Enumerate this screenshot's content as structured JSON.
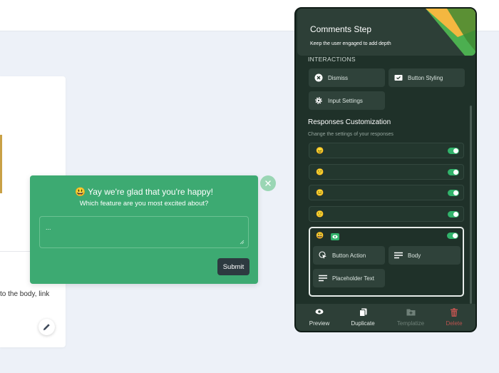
{
  "background_page": {
    "body_text": "to the body, link"
  },
  "popup": {
    "emoji": "😃",
    "title": "Yay we're glad that you're happy!",
    "subtitle": "Which feature are you most excited about?",
    "textarea_placeholder": "...",
    "submit_label": "Submit",
    "bg_color": "#3daa72"
  },
  "panel": {
    "title": "Comments Step",
    "subtitle": "Keep the user engaged to add depth",
    "interactions_label": "INTERACTIONS",
    "interactions": [
      {
        "label": "Dismiss",
        "icon": "close-circle-icon"
      },
      {
        "label": "Button Styling",
        "icon": "button-styling-icon"
      },
      {
        "label": "Input Settings",
        "icon": "gear-icon"
      }
    ],
    "responses_title": "Responses Customization",
    "responses_subtitle": "Change the settings of your responses",
    "responses": [
      {
        "emoji": "😠",
        "enabled": true
      },
      {
        "emoji": "😕",
        "enabled": true
      },
      {
        "emoji": "😐",
        "enabled": true
      },
      {
        "emoji": "🙂",
        "enabled": true
      },
      {
        "emoji": "😃",
        "enabled": true,
        "expanded": true
      }
    ],
    "expanded_options": [
      {
        "label": "Button Action",
        "icon": "pointer-click-icon"
      },
      {
        "label": "Body",
        "icon": "text-lines-icon"
      },
      {
        "label": "Placeholder Text",
        "icon": "text-lines-icon"
      }
    ],
    "footer": [
      {
        "label": "Preview",
        "icon": "eye-icon"
      },
      {
        "label": "Duplicate",
        "icon": "copy-icon"
      },
      {
        "label": "Templatize",
        "icon": "folder-plus-icon"
      },
      {
        "label": "Delete",
        "icon": "trash-icon"
      }
    ],
    "colors": {
      "accent": "#31b36b",
      "panel_bg": "#1f3129",
      "danger": "#b9534f"
    }
  }
}
